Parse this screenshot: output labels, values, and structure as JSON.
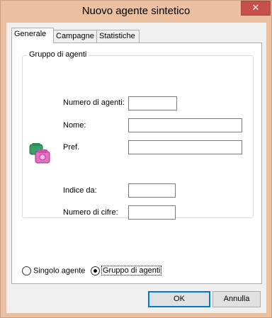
{
  "window": {
    "title": "Nuovo agente sintetico",
    "close_glyph": "✕"
  },
  "tabs": [
    {
      "label": "Generale",
      "active": true
    },
    {
      "label": "Campagne",
      "active": false
    },
    {
      "label": "Statistiche",
      "active": false
    }
  ],
  "group": {
    "label": "Gruppo di agenti",
    "fields": {
      "numero_agenti": {
        "label": "Numero di agenti:",
        "value": ""
      },
      "nome": {
        "label": "Nome:",
        "value": ""
      },
      "pref": {
        "label": "Pref.",
        "value": ""
      },
      "indice_da": {
        "label": "Indice da:",
        "value": ""
      },
      "numero_cifre": {
        "label": "Numero di cifre:",
        "value": ""
      }
    },
    "icon": "telephone-icon"
  },
  "mode": {
    "options": [
      {
        "label": "Singolo agente",
        "checked": false
      },
      {
        "label": "Gruppo di agenti",
        "checked": true
      }
    ]
  },
  "buttons": {
    "ok": "OK",
    "cancel": "Annulla"
  },
  "colors": {
    "frame": "#eac0a0",
    "close": "#c7504b",
    "accent": "#0078d7"
  }
}
